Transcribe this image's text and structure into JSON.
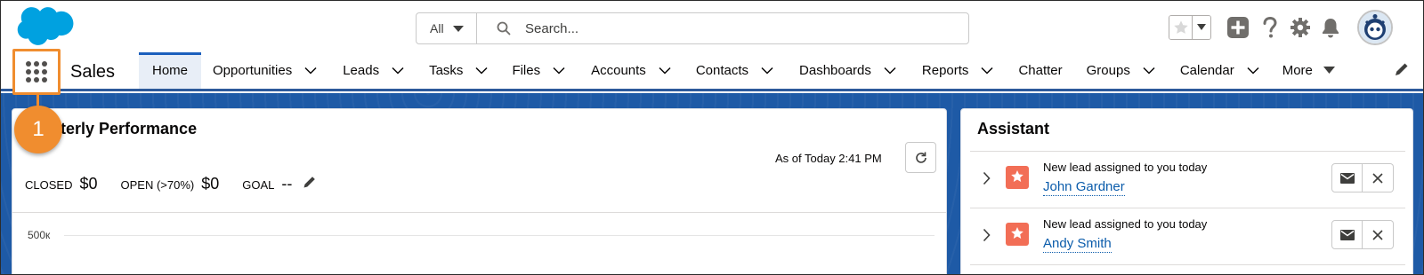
{
  "header": {
    "search": {
      "scope": "All",
      "placeholder": "Search..."
    }
  },
  "nav": {
    "app_name": "Sales",
    "items": [
      {
        "label": "Home",
        "dropdown": false,
        "active": true
      },
      {
        "label": "Opportunities",
        "dropdown": true
      },
      {
        "label": "Leads",
        "dropdown": true
      },
      {
        "label": "Tasks",
        "dropdown": true
      },
      {
        "label": "Files",
        "dropdown": true
      },
      {
        "label": "Accounts",
        "dropdown": true
      },
      {
        "label": "Contacts",
        "dropdown": true
      },
      {
        "label": "Dashboards",
        "dropdown": true
      },
      {
        "label": "Reports",
        "dropdown": true
      },
      {
        "label": "Chatter",
        "dropdown": false
      },
      {
        "label": "Groups",
        "dropdown": true
      },
      {
        "label": "Calendar",
        "dropdown": true
      }
    ],
    "more_label": "More"
  },
  "callout": {
    "number": "1"
  },
  "performance": {
    "title": "rterly Performance",
    "as_of": "As of Today 2:41 PM",
    "metrics": [
      {
        "label": "CLOSED",
        "value": "$0"
      },
      {
        "label": "OPEN (>70%)",
        "value": "$0"
      },
      {
        "label": "GOAL",
        "value": "--"
      }
    ],
    "chart_tick": "500к"
  },
  "assistant": {
    "title": "Assistant",
    "items": [
      {
        "text": "New lead assigned to you today",
        "name": "John Gardner"
      },
      {
        "text": "New lead assigned to you today",
        "name": "Andy Smith"
      }
    ]
  },
  "colors": {
    "accent": "#1b5fbd",
    "callout": "#f08d2f",
    "brand_blue": "#1e5aa6",
    "lead_icon": "#f26e56",
    "link": "#0b5cab"
  },
  "icons": [
    "salesforce-logo",
    "search-icon",
    "star-icon",
    "plus-icon",
    "help-icon",
    "gear-icon",
    "bell-icon",
    "avatar",
    "app-launcher-icon",
    "chevron-down-icon",
    "pencil-icon",
    "refresh-icon",
    "lead-icon",
    "email-icon",
    "close-icon"
  ]
}
